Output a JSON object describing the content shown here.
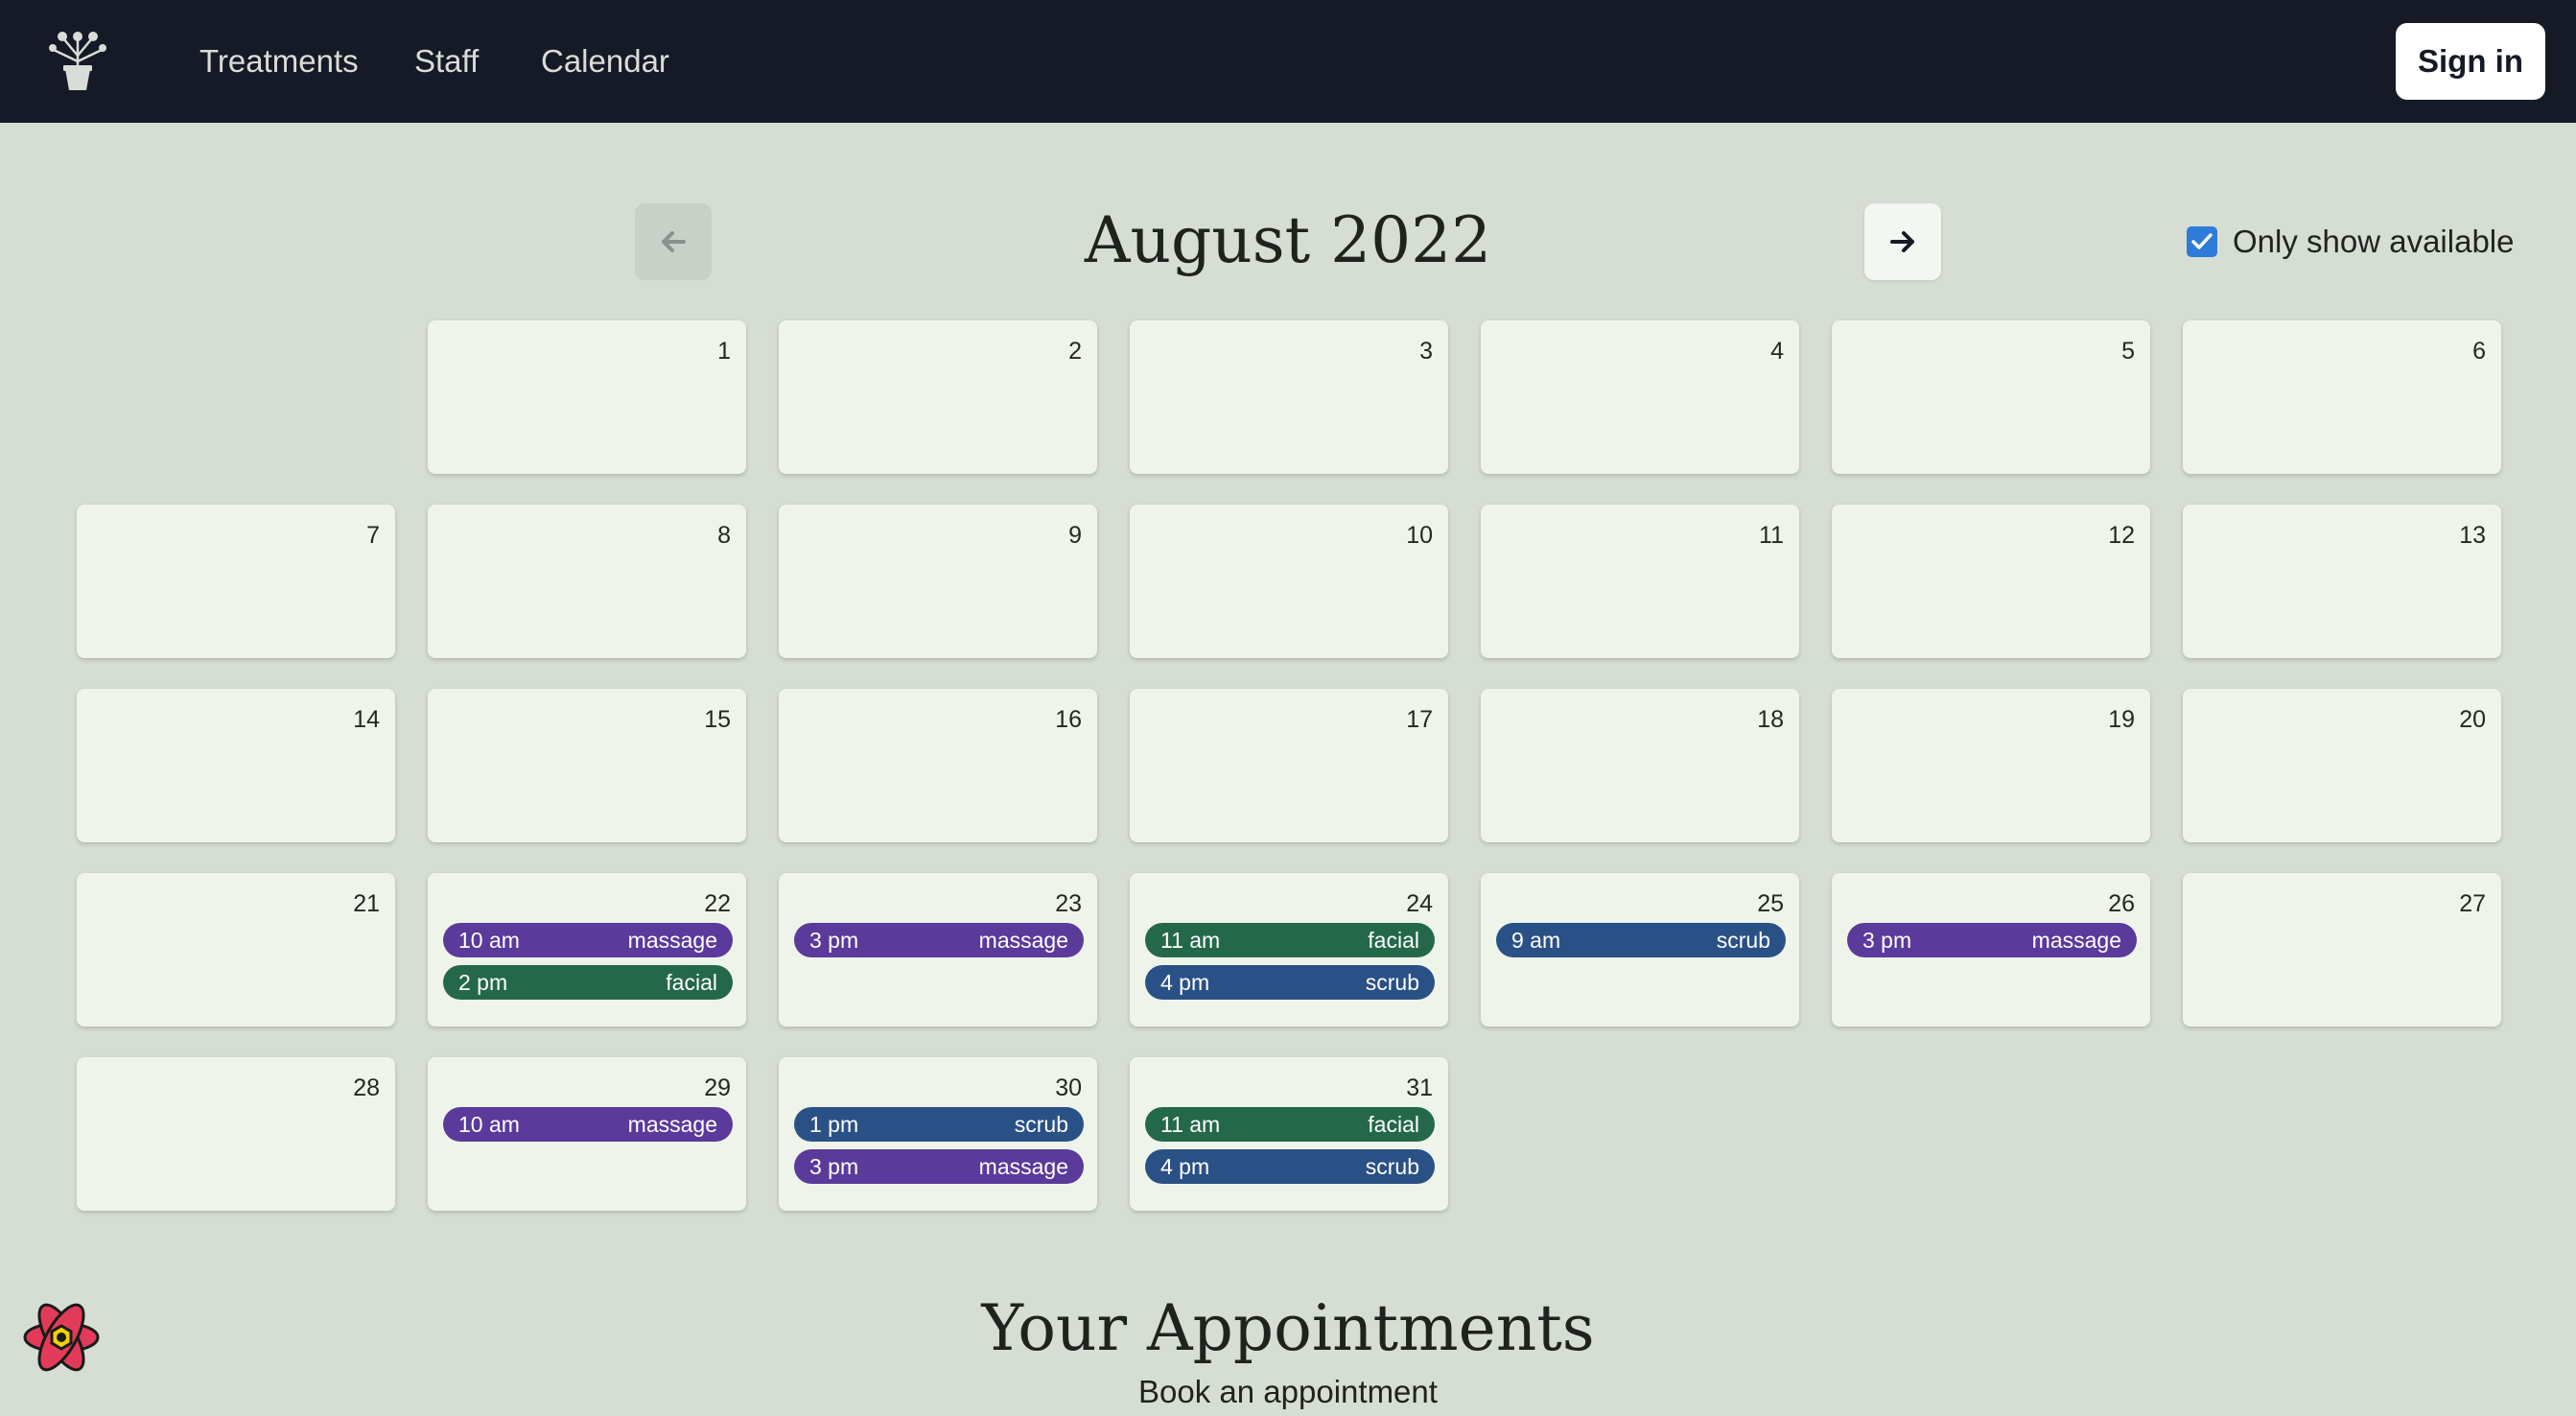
{
  "nav": {
    "links": [
      "Treatments",
      "Staff",
      "Calendar"
    ],
    "signin_label": "Sign in",
    "logo_icon": "flower-pot-icon"
  },
  "calendar": {
    "month_title": "August 2022",
    "prev_icon": "arrow-left-icon",
    "next_icon": "arrow-right-icon",
    "only_available_label": "Only show available",
    "only_available_checked": true,
    "first_weekday_offset": 1,
    "days": [
      {
        "day": "1",
        "appointments": []
      },
      {
        "day": "2",
        "appointments": []
      },
      {
        "day": "3",
        "appointments": []
      },
      {
        "day": "4",
        "appointments": []
      },
      {
        "day": "5",
        "appointments": []
      },
      {
        "day": "6",
        "appointments": []
      },
      {
        "day": "7",
        "appointments": []
      },
      {
        "day": "8",
        "appointments": []
      },
      {
        "day": "9",
        "appointments": []
      },
      {
        "day": "10",
        "appointments": []
      },
      {
        "day": "11",
        "appointments": []
      },
      {
        "day": "12",
        "appointments": []
      },
      {
        "day": "13",
        "appointments": []
      },
      {
        "day": "14",
        "appointments": []
      },
      {
        "day": "15",
        "appointments": []
      },
      {
        "day": "16",
        "appointments": []
      },
      {
        "day": "17",
        "appointments": []
      },
      {
        "day": "18",
        "appointments": []
      },
      {
        "day": "19",
        "appointments": []
      },
      {
        "day": "20",
        "appointments": []
      },
      {
        "day": "21",
        "appointments": []
      },
      {
        "day": "22",
        "appointments": [
          {
            "time": "10 am",
            "treatment": "massage"
          },
          {
            "time": "2 pm",
            "treatment": "facial"
          }
        ]
      },
      {
        "day": "23",
        "appointments": [
          {
            "time": "3 pm",
            "treatment": "massage"
          }
        ]
      },
      {
        "day": "24",
        "appointments": [
          {
            "time": "11 am",
            "treatment": "facial"
          },
          {
            "time": "4 pm",
            "treatment": "scrub"
          }
        ]
      },
      {
        "day": "25",
        "appointments": [
          {
            "time": "9 am",
            "treatment": "scrub"
          }
        ]
      },
      {
        "day": "26",
        "appointments": [
          {
            "time": "3 pm",
            "treatment": "massage"
          }
        ]
      },
      {
        "day": "27",
        "appointments": []
      },
      {
        "day": "28",
        "appointments": []
      },
      {
        "day": "29",
        "appointments": [
          {
            "time": "10 am",
            "treatment": "massage"
          }
        ]
      },
      {
        "day": "30",
        "appointments": [
          {
            "time": "1 pm",
            "treatment": "scrub"
          },
          {
            "time": "3 pm",
            "treatment": "massage"
          }
        ]
      },
      {
        "day": "31",
        "appointments": [
          {
            "time": "11 am",
            "treatment": "facial"
          },
          {
            "time": "4 pm",
            "treatment": "scrub"
          }
        ]
      }
    ],
    "treatment_colors": {
      "massage": "#5a3a9a",
      "facial": "#24684a",
      "scrub": "#2a5186"
    }
  },
  "appointments_section": {
    "title": "Your Appointments",
    "book_link": "Book an appointment"
  },
  "devtools_icon": "react-logo-icon"
}
